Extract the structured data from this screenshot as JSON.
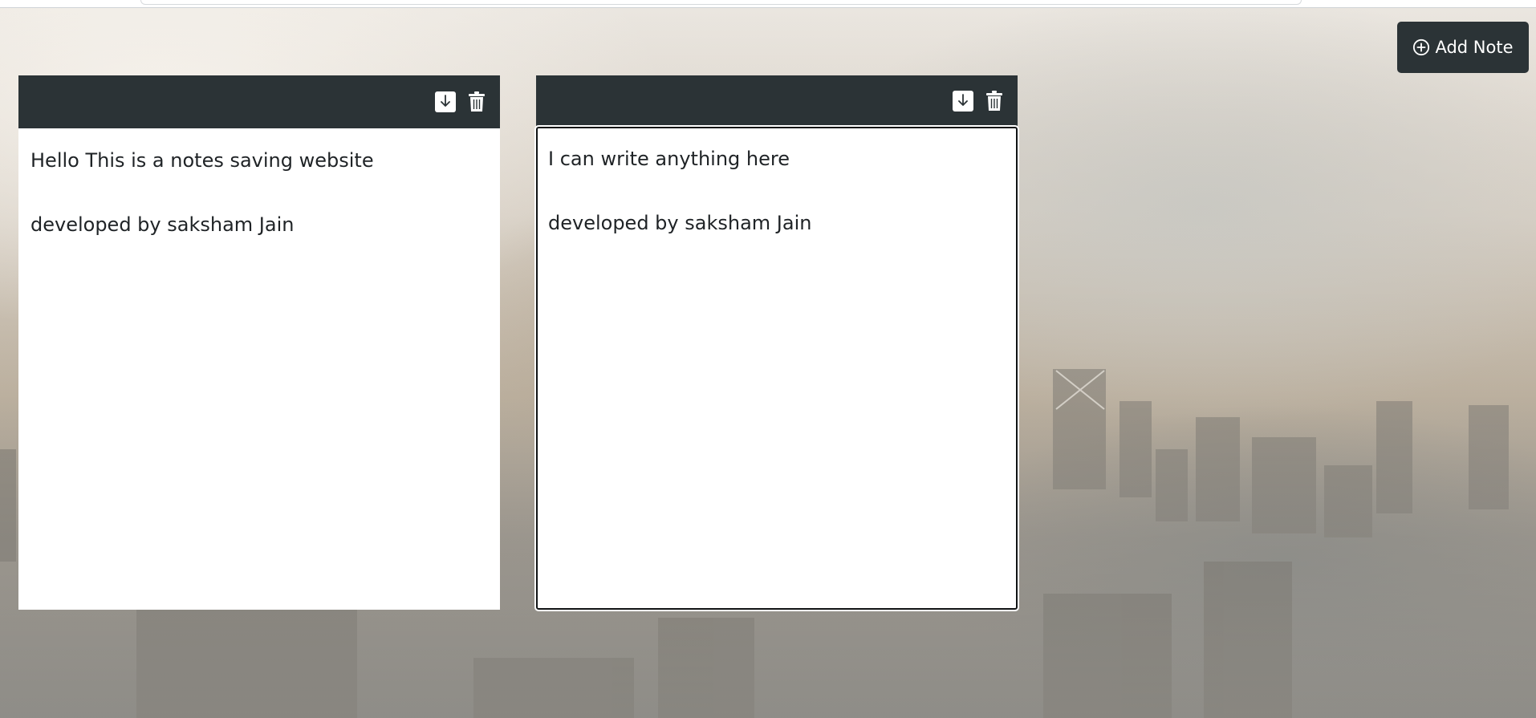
{
  "header": {
    "add_note_label": "Add Note"
  },
  "notes": [
    {
      "lines": [
        "Hello This is a notes saving website",
        "",
        "developed by saksham Jain"
      ],
      "icons": [
        "download-icon",
        "trash-icon"
      ]
    },
    {
      "lines": [
        "I can write anything here",
        "",
        "developed by saksham Jain"
      ],
      "icons": [
        "download-icon",
        "trash-icon"
      ],
      "focused": true
    }
  ],
  "colors": {
    "toolbar": "#2b3336",
    "button": "#2b3336",
    "note_body": "#ffffff"
  }
}
